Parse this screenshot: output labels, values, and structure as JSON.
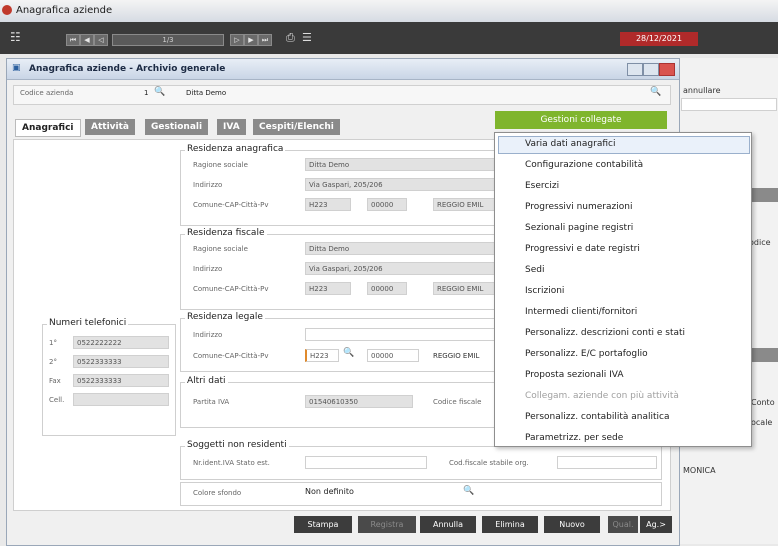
{
  "app_title": "Anagrafica aziende",
  "toolbar": {
    "page_indicator": "1/3",
    "date": "28/12/2021"
  },
  "window": {
    "title": "Anagrafica aziende - Archivio generale"
  },
  "company": {
    "code_label": "Codice azienda",
    "code_value": "1",
    "name_value": "Ditta Demo"
  },
  "tabs": [
    "Anagrafici",
    "Attività",
    "Gestionali",
    "IVA",
    "Cespiti/Elenchi"
  ],
  "linked_button": "Gestioni collegate",
  "menu_items": [
    {
      "label": "Varia dati anagrafici",
      "disabled": false
    },
    {
      "label": "Configurazione contabilità",
      "disabled": false
    },
    {
      "label": "Esercizi",
      "disabled": false
    },
    {
      "label": "Progressivi numerazioni",
      "disabled": false
    },
    {
      "label": "Sezionali pagine registri",
      "disabled": false
    },
    {
      "label": "Progressivi e date registri",
      "disabled": false
    },
    {
      "label": "Sedi",
      "disabled": false
    },
    {
      "label": "Iscrizioni",
      "disabled": false
    },
    {
      "label": "Intermedi clienti/fornitori",
      "disabled": false
    },
    {
      "label": "Personalizz. descrizioni conti e stati",
      "disabled": false
    },
    {
      "label": "Personalizz. E/C portafoglio",
      "disabled": false
    },
    {
      "label": "Proposta sezionali IVA",
      "disabled": false
    },
    {
      "label": "Collegam. aziende con più attività",
      "disabled": true
    },
    {
      "label": "Personalizz. contabilità analitica",
      "disabled": false
    },
    {
      "label": "Parametrizz. per sede",
      "disabled": false
    }
  ],
  "residenza_anagrafica": {
    "title": "Residenza anagrafica",
    "ragione_label": "Ragione sociale",
    "ragione": "Ditta Demo",
    "indirizzo_label": "Indirizzo",
    "indirizzo": "Via Gaspari, 205/206",
    "comune_label": "Comune-CAP-Città-Pv",
    "comune": "H223",
    "cap": "00000",
    "citta": "REGGIO EMIL"
  },
  "residenza_fiscale": {
    "title": "Residenza fiscale",
    "ragione_label": "Ragione sociale",
    "ragione": "Ditta Demo",
    "indirizzo_label": "Indirizzo",
    "indirizzo": "Via Gaspari, 205/206",
    "comune_label": "Comune-CAP-Città-Pv",
    "comune": "H223",
    "cap": "00000",
    "citta": "REGGIO EMIL"
  },
  "residenza_legale": {
    "title": "Residenza legale",
    "indirizzo_label": "Indirizzo",
    "comune_label": "Comune-CAP-Città-Pv",
    "comune": "H223",
    "cap": "00000",
    "citta": "REGGIO EMIL"
  },
  "numeri_telefonici": {
    "title": "Numeri telefonici",
    "rows": [
      {
        "label": "1°",
        "value": "0522222222"
      },
      {
        "label": "2°",
        "value": "0522333333"
      },
      {
        "label": "Fax",
        "value": "0522333333"
      },
      {
        "label": "Cell.",
        "value": ""
      }
    ]
  },
  "altri_dati": {
    "title": "Altri dati",
    "piva_label": "Partita IVA",
    "piva": "01540610350",
    "cf_label": "Codice fiscale"
  },
  "soggetti_non_residenti": {
    "title": "Soggetti non residenti",
    "id_iva_label": "Nr.ident.IVA Stato est.",
    "cod_fisc_label": "Cod.fiscale stabile org."
  },
  "colore": {
    "label": "Colore sfondo",
    "value": "Non definito"
  },
  "bottom_buttons": [
    {
      "label": "Stampa",
      "disabled": false
    },
    {
      "label": "Registra",
      "disabled": true
    },
    {
      "label": "Annulla",
      "disabled": false
    },
    {
      "label": "Elimina",
      "disabled": false
    },
    {
      "label": "Nuovo",
      "disabled": false
    },
    {
      "label": "Qual.",
      "disabled": true
    },
    {
      "label": "Ag.>",
      "disabled": false
    }
  ],
  "right_window": {
    "annullare": "annullare",
    "codice": "odice",
    "monica": "MONICA",
    "conto": "Conto",
    "locale": "ocale"
  }
}
